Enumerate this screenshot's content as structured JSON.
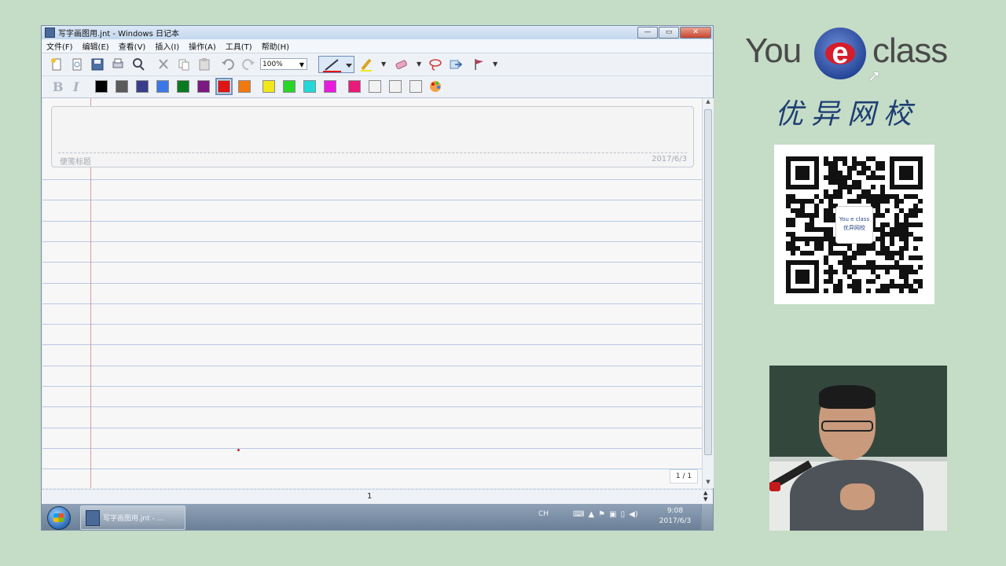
{
  "window": {
    "title": "写字画图用.jnt - Windows 日记本",
    "buttons": {
      "minimize": "—",
      "maximize": "▭",
      "close": "✕"
    }
  },
  "menu": [
    "文件(F)",
    "编辑(E)",
    "查看(V)",
    "插入(I)",
    "操作(A)",
    "工具(T)",
    "帮助(H)"
  ],
  "toolbar": {
    "icons": [
      "new-note-icon",
      "open-icon",
      "save-icon",
      "print-preview-icon",
      "find-icon",
      "cut-icon",
      "copy-icon",
      "paste-icon",
      "undo-icon",
      "redo-icon"
    ],
    "zoom": "100%",
    "tools": [
      "pen-icon",
      "highlighter-icon",
      "eraser-icon",
      "lasso-icon",
      "insert-space-icon",
      "flag-icon"
    ]
  },
  "format_toolbar": {
    "bold": "B",
    "italic": "I",
    "colors": [
      "#000000",
      "#5a5a5a",
      "#3a3d8a",
      "#3b78e7",
      "#0a7a20",
      "#7a1a82",
      "#e01515",
      "#f07a10",
      "#f0e81a",
      "#28d628",
      "#22d8d8",
      "#e81ae0",
      "#e81a7a",
      "#f2f2f2",
      "#f2f2f2",
      "#f2f2f2"
    ],
    "selected_color_index": 6
  },
  "page": {
    "note_title_placeholder": "便笺标题",
    "note_date": "2017/6/3",
    "page_indicator": "1 / 1",
    "page_number": "1"
  },
  "taskbar": {
    "task_label": "写字画图用.jnt - ...",
    "lang": "CH",
    "time": "9:08",
    "date": "2017/6/3"
  },
  "branding": {
    "logo_left": "You",
    "logo_e": "e",
    "logo_right": "class",
    "chinese_name": "优异网校",
    "qr_center_en": "You e class",
    "qr_center_cn": "优异网校"
  }
}
